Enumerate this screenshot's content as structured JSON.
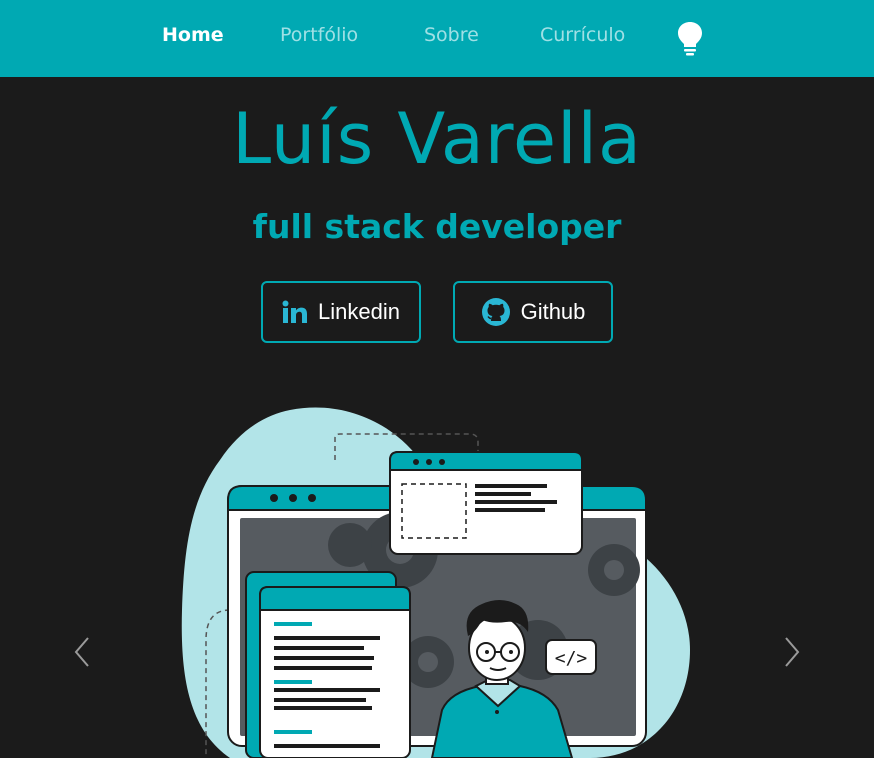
{
  "nav": {
    "items": [
      {
        "label": "Home",
        "active": true
      },
      {
        "label": "Portfólio",
        "active": false
      },
      {
        "label": "Sobre",
        "active": false
      },
      {
        "label": "Currículo",
        "active": false
      }
    ],
    "theme_toggle_icon": "lightbulb-icon"
  },
  "hero": {
    "name": "Luís Varella",
    "role": "full stack developer"
  },
  "social": {
    "linkedin": {
      "label": "Linkedin",
      "icon": "linkedin-icon"
    },
    "github": {
      "label": "Github",
      "icon": "github-icon"
    }
  },
  "illustration": {
    "icon": "developer-illustration",
    "code_tag": "</>"
  },
  "carousel": {
    "prev_icon": "chevron-left-icon",
    "next_icon": "chevron-right-icon"
  },
  "colors": {
    "accent": "#00a9b3",
    "background": "#1b1b1b",
    "light_accent": "#b2e4e8"
  }
}
